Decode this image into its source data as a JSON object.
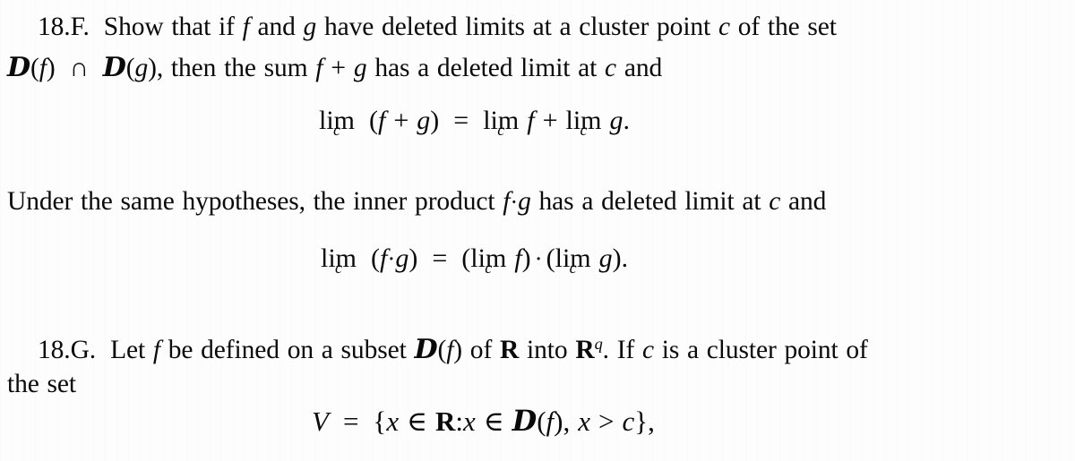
{
  "page": {
    "background_color": "#fdfdfe",
    "text_color": "#0a0a0a",
    "kind": "scanned-textbook-page"
  },
  "cut_off_top_line": {
    "text": "·  ·   ·    ·  ·  ·    ·· ·     ·      ·   ·"
  },
  "exercises": [
    {
      "id": "18.F",
      "label": "18.F.",
      "lines": [
        "Show that if f and g have deleted limits at a cluster point c of the set",
        "D(f) ∩ D(g), then the sum f + g has a deleted limit at c and"
      ],
      "line1_parts": {
        "a": "Show that if ",
        "f": "f",
        "b": " and ",
        "g": "g",
        "c": " have deleted limits at a cluster point ",
        "cvar": "c",
        "d": " of the set"
      },
      "line2_parts": {
        "D1": "D",
        "open1": "(",
        "f": "f",
        "close1": ")",
        "cap": "∩",
        "D2": "D",
        "open2": "(",
        "g": "g",
        "close2": "), then the sum ",
        "fplusg_f": "f",
        "plus": "+",
        "fplusg_g": "g",
        "tail": " has a deleted limit at ",
        "cvar": "c",
        "end": " and"
      }
    },
    {
      "id": "18.G",
      "label": "18.G.",
      "lines": [
        "Let f be defined on a subset D(f) of R into Rq. If c is a cluster point of",
        "the set"
      ],
      "line1_parts": {
        "a": "Let ",
        "f": "f",
        "b": " be defined on a subset ",
        "D": "D",
        "open": "(",
        "f2": "f",
        "close": ") of ",
        "R1": "R",
        "c": " into ",
        "R2": "R",
        "q": "q",
        "d": ". If ",
        "cvar": "c",
        "e": " is a cluster point of"
      },
      "line2": "the set"
    }
  ],
  "middle_paragraph": {
    "parts": {
      "a": "Under the same hypotheses, the inner product ",
      "f": "f",
      "dot": "·",
      "g": "g",
      "b": " has a deleted limit at ",
      "cvar": "c",
      "c": " and"
    },
    "text": "Under the same hypotheses, the inner product f·g has a deleted limit at c and"
  },
  "equations": [
    {
      "id": "eq-sum-limit",
      "plain": "lim_c (f + g) = lim_c f + lim_c g.",
      "parts": {
        "lim1_op": "lim",
        "lim1_sub": "c",
        "open": "(",
        "f": "f",
        "plus": "+",
        "g": "g",
        "close": ")",
        "equals": "=",
        "lim2_op": "lim",
        "lim2_sub": "c",
        "f2": "f",
        "plus2": "+",
        "lim3_op": "lim",
        "lim3_sub": "c",
        "g2": "g",
        "period": "."
      }
    },
    {
      "id": "eq-product-limit",
      "plain": "lim_c (f·g) = (lim_c f) · (lim_c g).",
      "parts": {
        "lim1_op": "lim",
        "lim1_sub": "c",
        "open": "(",
        "f": "f",
        "dot": "·",
        "g": "g",
        "close": ")",
        "equals": "=",
        "popen1": "(",
        "lim2_op": "lim",
        "lim2_sub": "c",
        "f2": "f",
        "pclose1": ")",
        "cdot": "·",
        "popen2": "(",
        "lim3_op": "lim",
        "lim3_sub": "c",
        "g2": "g",
        "pclose2": ")",
        "period": "."
      }
    },
    {
      "id": "eq-set-V",
      "plain": "V = {x ∈ R : x ∈ D(f), x > c},",
      "parts": {
        "V": "V",
        "equals": "=",
        "lbrace": "{",
        "x1": "x",
        "in1": "∈",
        "R": "R",
        "colon": ":",
        "x2": "x",
        "in2": "∈",
        "D": "D",
        "open": "(",
        "f": "f",
        "close": ")",
        "comma1": ",",
        "x3": "x",
        "gt": ">",
        "cvar": "c",
        "rbrace": "}",
        "comma2": ","
      }
    }
  ]
}
